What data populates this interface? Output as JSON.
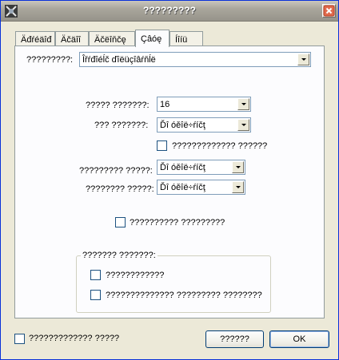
{
  "window": {
    "title": "?????????"
  },
  "tabs": [
    {
      "label": "Äđŕéäîđ",
      "active": false
    },
    {
      "label": "Äčäîî",
      "active": false
    },
    {
      "label": "Äčëîňčę",
      "active": false
    },
    {
      "label": "Çâóę",
      "active": true
    },
    {
      "label": "Íîíü",
      "active": false
    }
  ],
  "font_row": {
    "label": "?????????:",
    "value": "Îřŕđîéĺč ďîëüçîâŕňĺë"
  },
  "size_row": {
    "label": "????? ???????:",
    "value": "16"
  },
  "style_row": {
    "label": "??? ???????:",
    "value": "Ďî óěîë÷ŕíčţ"
  },
  "style_checkbox": {
    "label": "????????????? ??????"
  },
  "color1_row": {
    "label": "????????? ?????:",
    "value": "Ďî óěîë÷ŕíčţ"
  },
  "color2_row": {
    "label": "???????? ?????:",
    "value": "Ďî óěîë÷ŕíčţ"
  },
  "mid_checkbox": {
    "label": "?????????? ?????????"
  },
  "group": {
    "title": "??????? ???????:",
    "options": [
      {
        "label": "????????????"
      },
      {
        "label": "?????????????? ????????? ????????"
      }
    ]
  },
  "bottom_checkbox": {
    "label": "????????????? ?????"
  },
  "buttons": {
    "apply": "??????",
    "ok": "OK"
  }
}
